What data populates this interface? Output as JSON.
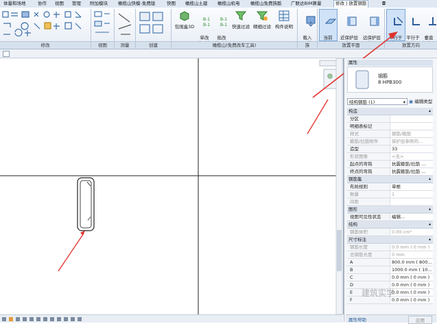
{
  "menu_tabs": [
    "体量和场地",
    "协作",
    "视图",
    "管理",
    "附加模块",
    "橄榄山快模-免费版",
    "快图",
    "橄榄山土建",
    "橄榄山机电",
    "橄榄山免费族酷",
    "广联达BIM算量",
    "修改 | 放置钢筋"
  ],
  "menu_extra": "◘",
  "ribbon": {
    "groups": [
      "修改",
      "视图",
      "测量",
      "创建",
      "橄榄山(免费改车工具)",
      "族",
      "放置平面",
      "放置方向"
    ],
    "tools": {
      "rebar_3d": "包围盒3D",
      "type_name": "单改\n类型名",
      "multi_type_name": "批改\n类型名",
      "quick_filter": "快速过滤",
      "precise_filter": "精细过滤",
      "component_desc": "构件说明",
      "load_shape": "载入\n形状",
      "current_plane": "当前\n工作平面",
      "near_cover": "近保护层\n参照",
      "far_cover": "远保护层\n参照",
      "parallel_plane": "平行于\n工作平面",
      "parallel_cover": "平行于\n保护层",
      "perpendicular": "垂直\n保护层"
    },
    "accent": "#3a78c2"
  },
  "properties": {
    "title": "属性",
    "preview_name": "钢筋",
    "preview_type": "8 HPB300",
    "selector": "结构钢筋 (1)",
    "edit_type": "编辑类型",
    "sections": [
      {
        "name": "构造",
        "rows": [
          {
            "k": "分区",
            "v": "",
            "dim": false
          },
          {
            "k": "明细表标记",
            "v": "",
            "dim": false
          },
          {
            "k": "样式",
            "v": "钢筋/箍筋",
            "dim": true
          },
          {
            "k": "箍筋/拉筋附件",
            "v": "保护层参照的...",
            "dim": true
          },
          {
            "k": "造型",
            "v": "33",
            "dim": false
          },
          {
            "k": "形状图像",
            "v": "<无>",
            "dim": true
          },
          {
            "k": "起点的弯钩",
            "v": "抗震箍筋/拉筋 ...",
            "dim": false
          },
          {
            "k": "终点的弯钩",
            "v": "抗震箍筋/拉筋 ...",
            "dim": false
          }
        ]
      },
      {
        "name": "钢筋集",
        "rows": [
          {
            "k": "布局规则",
            "v": "单根",
            "dim": false
          },
          {
            "k": "数量",
            "v": "1",
            "dim": true
          },
          {
            "k": "间距",
            "v": "",
            "dim": true
          }
        ]
      },
      {
        "name": "图形",
        "rows": [
          {
            "k": "视图可见性状态",
            "v": "编辑...",
            "dim": false
          }
        ]
      },
      {
        "name": "结构",
        "rows": [
          {
            "k": "钢筋体积",
            "v": "0.00 cm³",
            "dim": true
          }
        ]
      },
      {
        "name": "尺寸标注",
        "rows": [
          {
            "k": "钢筋长度",
            "v": "0.0 mm ( 0 mm )",
            "dim": true
          },
          {
            "k": "总钢筋长度",
            "v": "0 mm",
            "dim": true
          },
          {
            "k": "A",
            "v": "800.0 mm ( 800...",
            "dim": false
          },
          {
            "k": "B",
            "v": "1000.0 mm ( 10...",
            "dim": false
          },
          {
            "k": "C",
            "v": "0.0 mm ( 0 mm )",
            "dim": false
          },
          {
            "k": "D",
            "v": "0.0 mm ( 0 mm )",
            "dim": false
          },
          {
            "k": "E",
            "v": "0.0 mm ( 0 mm )",
            "dim": false
          },
          {
            "k": "F",
            "v": "0.0 mm ( 0 mm )",
            "dim": false
          }
        ]
      }
    ],
    "help": "属性帮助",
    "apply": "应用"
  },
  "watermark": "建筑实学"
}
